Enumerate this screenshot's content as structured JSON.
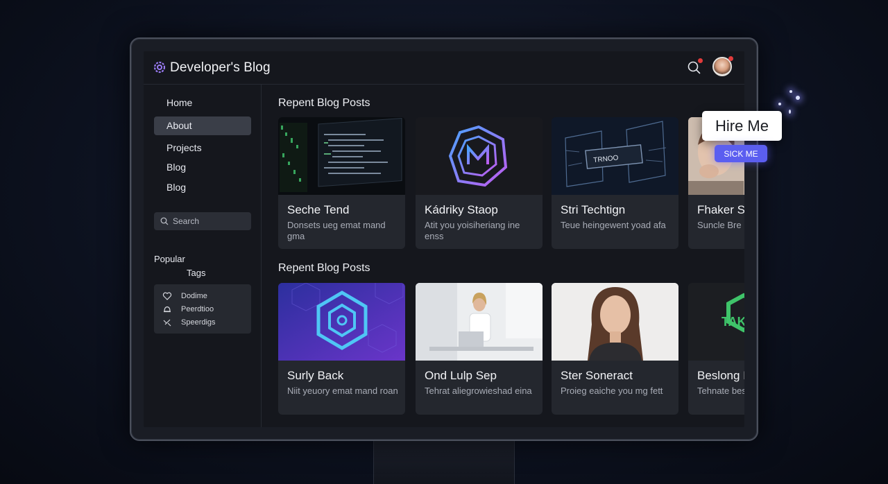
{
  "header": {
    "brand": "Developer's Blog",
    "logo_icon": "gear-icon",
    "search_icon": "search-icon"
  },
  "sidebar": {
    "items": [
      {
        "label": "Home",
        "active": false
      },
      {
        "label": "About",
        "active": true
      },
      {
        "label": "Projects",
        "active": false
      },
      {
        "label": "Blog",
        "active": false
      },
      {
        "label": "Blog",
        "active": false
      }
    ],
    "search_placeholder": "Search",
    "popular_title_1": "Popular",
    "popular_title_2": "Tags",
    "tags": [
      {
        "label": "Dodime",
        "icon": "heart-icon"
      },
      {
        "label": "Peerdtioo",
        "icon": "bell-icon"
      },
      {
        "label": "Speerdigs",
        "icon": "pointer-icon"
      }
    ]
  },
  "sections": [
    {
      "title": "Repent Blog Posts",
      "cards": [
        {
          "title": "Seche Tend",
          "excerpt": "Donsets ueg emat mand gma"
        },
        {
          "title": "Kádriky Staop",
          "excerpt": "Atit you yoisiheriang ine enss"
        },
        {
          "title": "Stri Techtign",
          "excerpt": "Teue heingewent yoad afa"
        },
        {
          "title": "Fhaker Su",
          "excerpt": "Suncle Bre rtigs"
        }
      ]
    },
    {
      "title": "Repent Blog Posts",
      "cards": [
        {
          "title": "Surly Back",
          "excerpt": "Niit yeuory emat mand roan"
        },
        {
          "title": "Ond Lulp Sep",
          "excerpt": "Tehrat aliegrowieshad eina"
        },
        {
          "title": "Ster Soneract",
          "excerpt": "Proieg eaiche you mg fett"
        },
        {
          "title": "Beslong I",
          "excerpt": "Tehnate bes rops"
        }
      ]
    }
  ],
  "thumb_texts": {
    "chip": "TRNOO",
    "tak": "TAK"
  },
  "cta": {
    "hire_me": "Hire Me",
    "sick_me": "SICK ME"
  },
  "colors": {
    "accent": "#5b5ef0",
    "notification": "#e23b3b",
    "active_nav": "#3a3e48"
  }
}
